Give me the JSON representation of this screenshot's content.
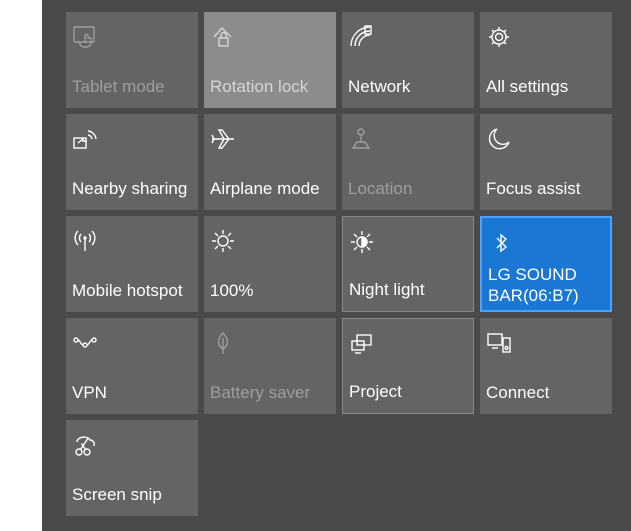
{
  "tiles": [
    {
      "label": "Tablet mode",
      "icon": "tablet-mode-icon",
      "state": "disabled"
    },
    {
      "label": "Rotation lock",
      "icon": "rotation-lock-icon",
      "state": "disabled"
    },
    {
      "label": "Network",
      "icon": "network-icon",
      "state": "off"
    },
    {
      "label": "All settings",
      "icon": "gear-icon",
      "state": "off"
    },
    {
      "label": "Nearby sharing",
      "icon": "nearby-sharing-icon",
      "state": "off"
    },
    {
      "label": "Airplane mode",
      "icon": "airplane-icon",
      "state": "off"
    },
    {
      "label": "Location",
      "icon": "location-icon",
      "state": "disabled"
    },
    {
      "label": "Focus assist",
      "icon": "moon-icon",
      "state": "off"
    },
    {
      "label": "Mobile hotspot",
      "icon": "hotspot-icon",
      "state": "off"
    },
    {
      "label": "100%",
      "icon": "brightness-icon",
      "state": "off"
    },
    {
      "label": "Night light",
      "icon": "night-light-icon",
      "state": "off"
    },
    {
      "label": "LG SOUND BAR(06:B7)",
      "icon": "bluetooth-icon",
      "state": "on"
    },
    {
      "label": "VPN",
      "icon": "vpn-icon",
      "state": "off"
    },
    {
      "label": "Battery saver",
      "icon": "battery-saver-icon",
      "state": "disabled"
    },
    {
      "label": "Project",
      "icon": "project-icon",
      "state": "off"
    },
    {
      "label": "Connect",
      "icon": "connect-icon",
      "state": "off"
    },
    {
      "label": "Screen snip",
      "icon": "screen-snip-icon",
      "state": "off"
    }
  ],
  "colors": {
    "panel": "#4a4a4a",
    "tile": "#646464",
    "accent": "#1a78d4"
  }
}
